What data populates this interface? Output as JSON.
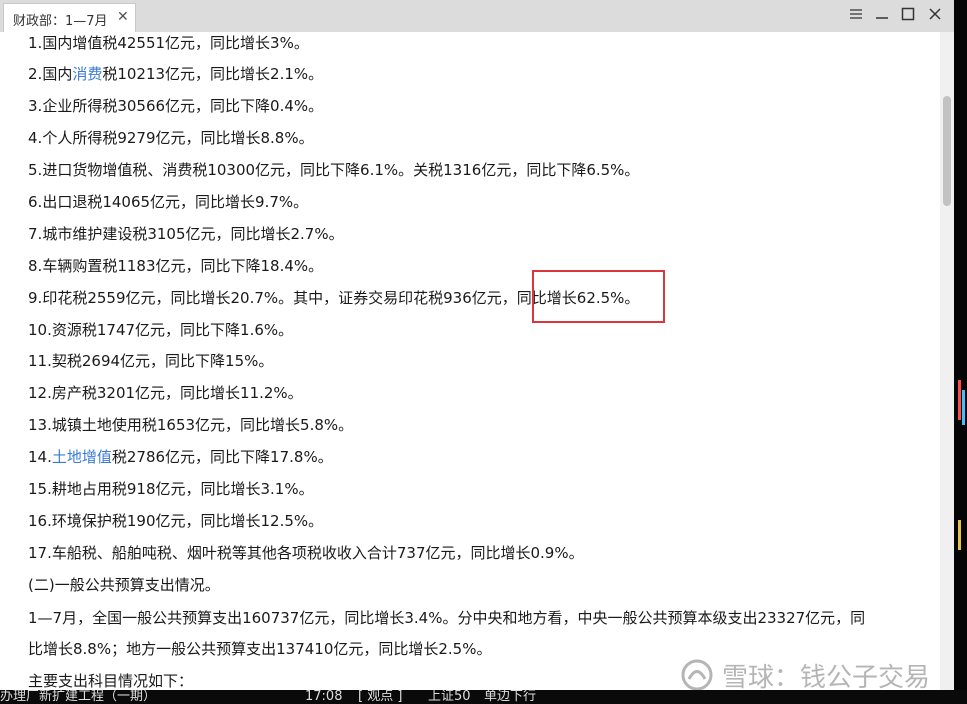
{
  "tab": {
    "title": "财政部：1—7月"
  },
  "lines": [
    {
      "num": "1.",
      "pre": "国内增值税42551亿元，同比增长3%。"
    },
    {
      "num": "2.",
      "pre": "国内",
      "link": "消费",
      "post": "税10213亿元，同比增长2.1%。"
    },
    {
      "num": "3.",
      "pre": "企业所得税30566亿元，同比下降0.4%。"
    },
    {
      "num": "4.",
      "pre": "个人所得税9279亿元，同比增长8.8%。"
    },
    {
      "num": "5.",
      "pre": "进口货物增值税、消费税10300亿元，同比下降6.1%。关税1316亿元，同比下降6.5%。"
    },
    {
      "num": "6.",
      "pre": "出口退税14065亿元，同比增长9.7%。"
    },
    {
      "num": "7.",
      "pre": "城市维护建设税3105亿元，同比增长2.7%。"
    },
    {
      "num": "8.",
      "pre": "车辆购置税1183亿元，同比下降18.4%。"
    },
    {
      "num": "9.",
      "pre": "印花税2559亿元，同比增长20.7%。其中，证券交易印花税936亿元，同比增长62.5%。"
    },
    {
      "num": "10.",
      "pre": "资源税1747亿元，同比下降1.6%。"
    },
    {
      "num": "11.",
      "pre": "契税2694亿元，同比下降15%。"
    },
    {
      "num": "12.",
      "pre": "房产税3201亿元，同比增长11.2%。"
    },
    {
      "num": "13.",
      "pre": "城镇土地使用税1653亿元，同比增长5.8%。"
    },
    {
      "num": "14.",
      "pre": "",
      "link": "土地增值",
      "post": "税2786亿元，同比下降17.8%。"
    },
    {
      "num": "15.",
      "pre": "耕地占用税918亿元，同比增长3.1%。"
    },
    {
      "num": "16.",
      "pre": "环境保护税190亿元，同比增长12.5%。"
    },
    {
      "num": "17.",
      "pre": "车船税、船舶吨税、烟叶税等其他各项税收收入合计737亿元，同比增长0.9%。"
    }
  ],
  "section_heading": "(二)一般公共预算支出情况。",
  "para_line1": "1—7月，全国一般公共预算支出160737亿元，同比增长3.4%。分中央和地方看，中央一般公共预算本级支出23327亿元，同",
  "para_line2": "比增长8.8%；地方一般公共预算支出137410亿元，同比增长2.5%。",
  "subheading": "主要支出科目情况如下：",
  "watermark": {
    "text": "雪球：钱公子交易"
  },
  "statusbar": {
    "left": "办理厂新扩建工程（一期）",
    "time": "17:08",
    "tag": "[ 观点 ]",
    "index": "上证50",
    "trend": "单边下行"
  },
  "colors": {
    "link": "#3a7bd5",
    "highlight": "#d9363e",
    "titlebar": "#dcdcdc"
  }
}
